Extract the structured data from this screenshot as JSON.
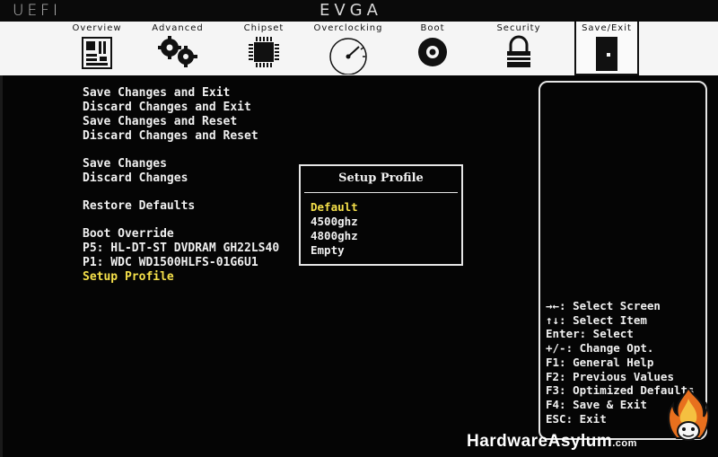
{
  "header": {
    "logo": "UEFI",
    "brand": "EVGA"
  },
  "tabs": [
    {
      "label": "Overview",
      "icon": "motherboard-icon"
    },
    {
      "label": "Advanced",
      "icon": "gears-icon"
    },
    {
      "label": "Chipset",
      "icon": "chip-icon"
    },
    {
      "label": "Overclocking",
      "icon": "gauge-icon"
    },
    {
      "label": "Boot",
      "icon": "disc-icon"
    },
    {
      "label": "Security",
      "icon": "lock-icon"
    },
    {
      "label": "Save/Exit",
      "icon": "door-icon",
      "active": true
    }
  ],
  "menu": {
    "save_changes_exit": "Save Changes and Exit",
    "discard_changes_exit": "Discard Changes and Exit",
    "save_changes_reset": "Save Changes and Reset",
    "discard_changes_reset": "Discard Changes and Reset",
    "save_changes": "Save Changes",
    "discard_changes": "Discard Changes",
    "restore_defaults": "Restore Defaults",
    "boot_override": "Boot Override",
    "boot_p5": "P5: HL-DT-ST DVDRAM GH22LS40",
    "boot_p1": "P1: WDC WD1500HLFS-01G6U1",
    "setup_profile": "Setup Profile"
  },
  "popup": {
    "title": "Setup Profile",
    "options": [
      "Default",
      "4500ghz",
      "4800ghz",
      "Empty"
    ],
    "selected_index": 0
  },
  "help": {
    "select_screen": "→←: Select Screen",
    "select_item": "↑↓: Select Item",
    "enter": "Enter: Select",
    "change_opt": "+/-: Change Opt.",
    "f1": "F1: General Help",
    "f2": "F2: Previous Values",
    "f3": "F3: Optimized Defaults",
    "f4": "F4: Save & Exit",
    "esc": "ESC: Exit"
  },
  "watermark": {
    "text": "HardwareAsylum",
    "suffix": ".com"
  },
  "colors": {
    "background": "#050505",
    "text": "#f0f0f0",
    "highlight": "#f5e04a",
    "tabbar": "#f5f5f5"
  }
}
